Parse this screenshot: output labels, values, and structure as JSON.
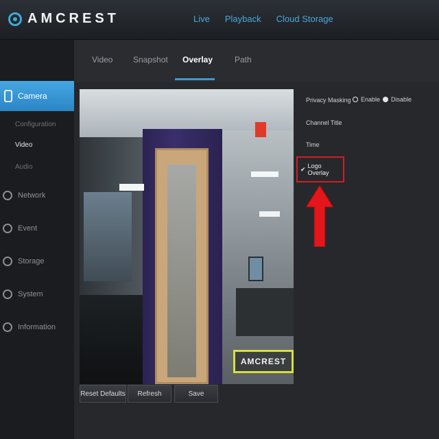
{
  "header": {
    "brand": "AMCREST",
    "nav": [
      "Live",
      "Playback",
      "Cloud Storage"
    ]
  },
  "sidebar": {
    "active": "Camera",
    "sub_items": [
      "Configuration",
      "Video",
      "Audio"
    ],
    "active_sub": "Video",
    "items": [
      "Network",
      "Event",
      "Storage",
      "System",
      "Information"
    ]
  },
  "tabs": [
    "Video",
    "Snapshot",
    "Overlay",
    "Path"
  ],
  "active_tab": "Overlay",
  "video_overlay_logo": "AMCREST",
  "buttons": [
    "Reset Defaults",
    "Refresh",
    "Save"
  ],
  "panel": {
    "privacy_masking": "Privacy Masking",
    "enable": "Enable",
    "disable": "Disable",
    "channel_title": "Channel Title",
    "time": "Time",
    "logo_overlay": "Logo Overlay",
    "check": "✔"
  },
  "colors": {
    "accent": "#3a9ad6",
    "highlight": "#d11f24"
  }
}
